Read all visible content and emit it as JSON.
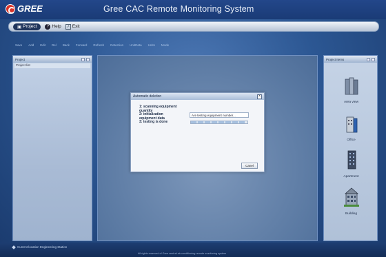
{
  "app": {
    "logo_text": "GREE",
    "title": "Gree CAC Remote Monitoring System"
  },
  "menubar": {
    "items": [
      {
        "label": "Project",
        "icon": "project-icon",
        "active": true
      },
      {
        "label": "Help",
        "icon": "help-icon"
      },
      {
        "label": "Exit",
        "icon": "exit-icon"
      }
    ]
  },
  "toolbar": {
    "items": [
      "Save",
      "Add",
      "Edit",
      "Del",
      "Back",
      "Forward",
      "Refresh",
      "Detection",
      "UnitData",
      "Units",
      "Mode"
    ]
  },
  "left_panel": {
    "title": "Project",
    "row": "Project list"
  },
  "right_panel": {
    "title": "Project Items",
    "items": [
      {
        "label": "Area view",
        "icon": "area-view-icon"
      },
      {
        "label": "Office",
        "icon": "office-icon"
      },
      {
        "label": "Apartment",
        "icon": "apartment-icon"
      },
      {
        "label": "Building",
        "icon": "building-icon"
      }
    ]
  },
  "dialog": {
    "title": "Automatic deletion",
    "steps": "1: scanning equipment quantity\n2: initialization equipment data\n3: testing is done",
    "status_text": "Are testing equipment number...",
    "progress": 0.95,
    "cancel_label": "Canel"
  },
  "statusbar": {
    "company": "Current location Engineering Station",
    "copyright": "All rights reserved of Gree central air-conditioning remote monitoring system"
  }
}
